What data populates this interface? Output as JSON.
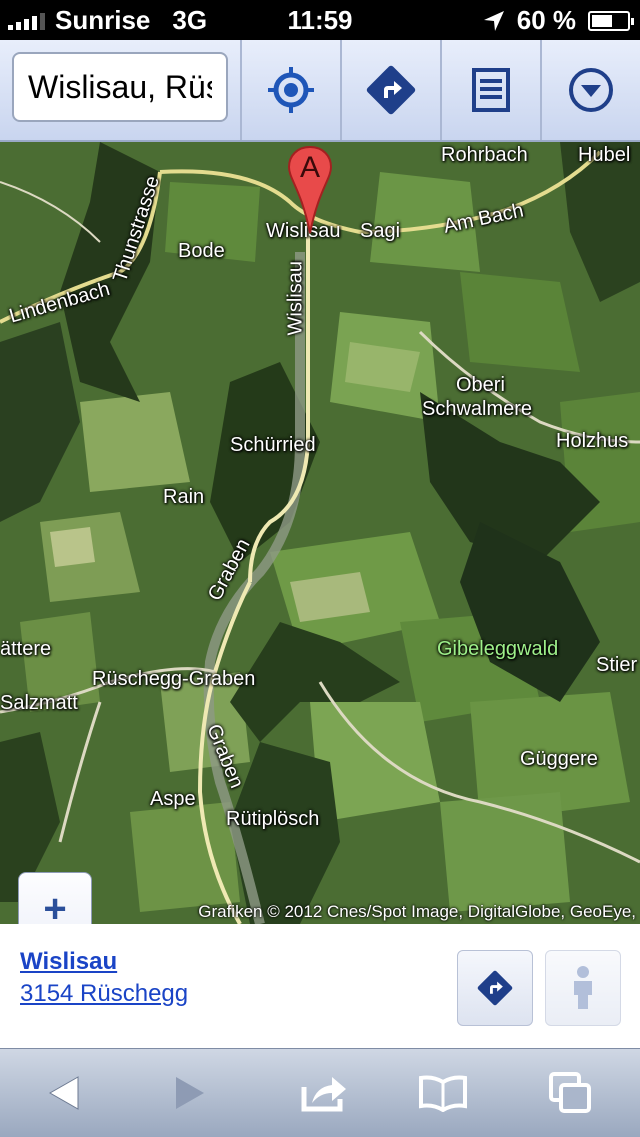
{
  "status": {
    "carrier": "Sunrise",
    "network": "3G",
    "time": "11:59",
    "battery": "60 %",
    "battery_level": 0.6
  },
  "toolbar": {
    "search_value": "Wislisau, Rüschegg"
  },
  "map": {
    "labels": [
      {
        "text": "Rohrbach",
        "style": "white"
      },
      {
        "text": "Hubel",
        "style": "white"
      },
      {
        "text": "Wislisau",
        "style": "white"
      },
      {
        "text": "Sagi",
        "style": "white"
      },
      {
        "text": "Am Bach",
        "style": "white"
      },
      {
        "text": "Bode",
        "style": "white"
      },
      {
        "text": "Thunstrasse",
        "style": "white"
      },
      {
        "text": "Lindenbach",
        "style": "white"
      },
      {
        "text": "Wislisau",
        "style": "white"
      },
      {
        "text": "Oberi",
        "style": "white"
      },
      {
        "text": "Schwalmere",
        "style": "white"
      },
      {
        "text": "Holzhus",
        "style": "white"
      },
      {
        "text": "Schürried",
        "style": "white"
      },
      {
        "text": "Rain",
        "style": "white"
      },
      {
        "text": "Graben",
        "style": "white"
      },
      {
        "text": "Gibeleggwald",
        "style": "green"
      },
      {
        "text": "ättere",
        "style": "white"
      },
      {
        "text": "Stier",
        "style": "white"
      },
      {
        "text": "Rüschegg-Graben",
        "style": "white"
      },
      {
        "text": "Salzmatt",
        "style": "white"
      },
      {
        "text": "Graben",
        "style": "white"
      },
      {
        "text": "Güggere",
        "style": "white"
      },
      {
        "text": "Aspe",
        "style": "white"
      },
      {
        "text": "Rütiplösch",
        "style": "white"
      }
    ],
    "marker_letter": "A",
    "zoom_in": "+",
    "zoom_out": "−",
    "attribution": "Grafiken © 2012 Cnes/Spot Image, DigitalGlobe, GeoEye,"
  },
  "result": {
    "name": "Wislisau",
    "address": "3154 Rüschegg"
  }
}
